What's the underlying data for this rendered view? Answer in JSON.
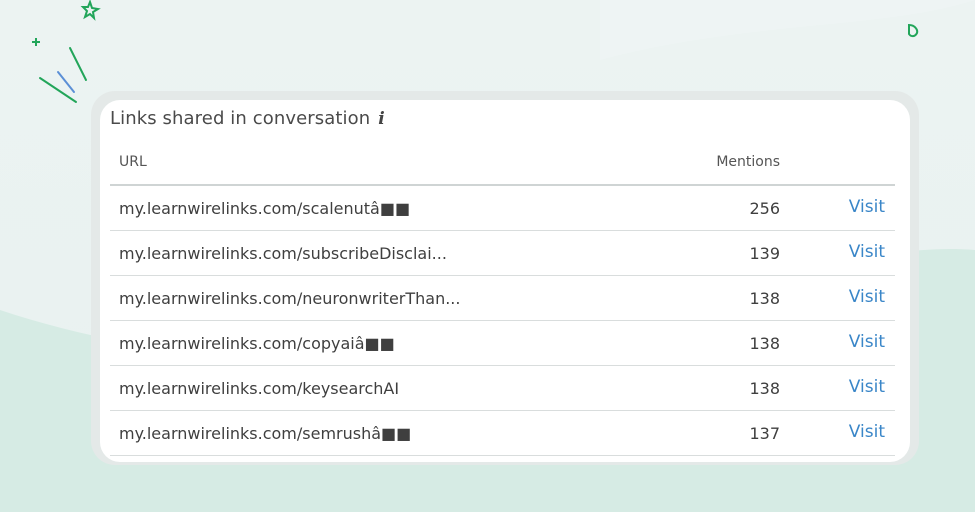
{
  "card": {
    "title": "Links shared in conversation",
    "info_icon": "info-icon"
  },
  "table": {
    "headers": {
      "url": "URL",
      "mentions": "Mentions"
    },
    "rows": [
      {
        "url": "my.learnwirelinks.com/scalenutâ■■",
        "mentions": "256",
        "action": "Visit"
      },
      {
        "url": "my.learnwirelinks.com/subscribeDisclai...",
        "mentions": "139",
        "action": "Visit"
      },
      {
        "url": "my.learnwirelinks.com/neuronwriterThan...",
        "mentions": "138",
        "action": "Visit"
      },
      {
        "url": "my.learnwirelinks.com/copyaiâ■■",
        "mentions": "138",
        "action": "Visit"
      },
      {
        "url": "my.learnwirelinks.com/keysearchAI",
        "mentions": "138",
        "action": "Visit"
      },
      {
        "url": "my.learnwirelinks.com/semrushâ■■",
        "mentions": "137",
        "action": "Visit"
      }
    ]
  },
  "colors": {
    "accent": "#3a86c8",
    "decoration": "#22a55a",
    "background": "#ecf3f2"
  }
}
